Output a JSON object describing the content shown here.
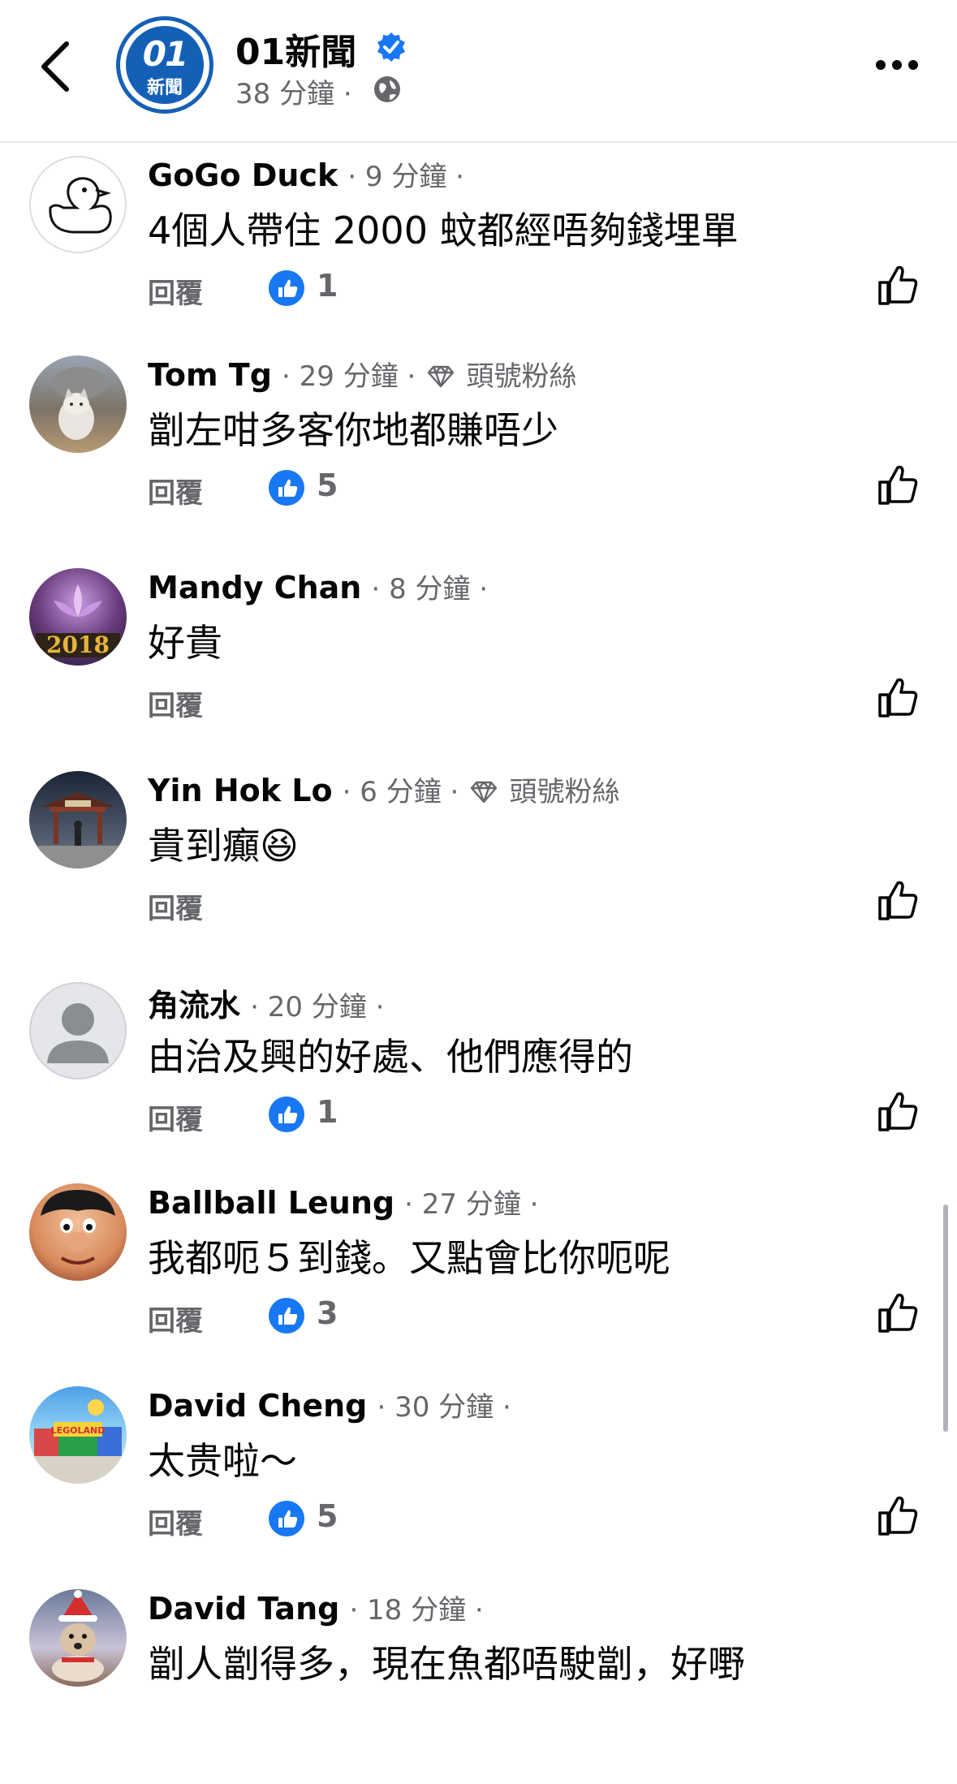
{
  "header": {
    "page_name": "01新聞",
    "post_time": "38 分鐘 ·",
    "logo_number": "01",
    "logo_text": "新聞"
  },
  "comments": [
    {
      "author": "GoGo Duck",
      "time": "· 9 分鐘 ·",
      "fan": "",
      "text": "4個人帶住 2000 蚊都經唔夠錢埋單",
      "reply": "回覆",
      "likes": "1",
      "avatar": "duck-outline-avatar"
    },
    {
      "author": "Tom Tg",
      "time": "· 29 分鐘 ·",
      "fan": "頭號粉絲",
      "text": "劏左咁多客你地都賺唔少",
      "reply": "回覆",
      "likes": "5",
      "avatar": "cat-photo-avatar"
    },
    {
      "author": "Mandy Chan",
      "time": "· 8 分鐘 ·",
      "fan": "",
      "text": "好貴",
      "reply": "回覆",
      "likes": "",
      "avatar": "lotus-2018-avatar"
    },
    {
      "author": "Yin Hok Lo",
      "time": "· 6 分鐘 ·",
      "fan": "頭號粉絲",
      "text": "貴到癲😆",
      "reply": "回覆",
      "likes": "",
      "avatar": "temple-photo-avatar"
    },
    {
      "author": "角流水",
      "time": "· 20 分鐘 ·",
      "fan": "",
      "text": "由治及興的好處、他們應得的",
      "reply": "回覆",
      "likes": "1",
      "avatar": "default-person-avatar"
    },
    {
      "author": "Ballball Leung",
      "time": "· 27 分鐘 ·",
      "fan": "",
      "text": "我都呃５到錢。又點會比你呃呢",
      "reply": "回覆",
      "likes": "3",
      "avatar": "cartoon-face-avatar"
    },
    {
      "author": "David Cheng",
      "time": "· 30 分鐘 ·",
      "fan": "",
      "text": "太贵啦～",
      "reply": "回覆",
      "likes": "5",
      "avatar": "legoland-photo-avatar"
    },
    {
      "author": "David Tang",
      "time": "· 18 分鐘 ·",
      "fan": "",
      "text": "劏人劏得多，現在魚都唔駛劏，好嘢",
      "reply": "回覆",
      "likes": "",
      "avatar": "dog-santa-avatar"
    }
  ],
  "colors": {
    "facebook_blue": "#1877f2",
    "meta_gray": "#65676b",
    "brand_blue": "#1560b7"
  }
}
